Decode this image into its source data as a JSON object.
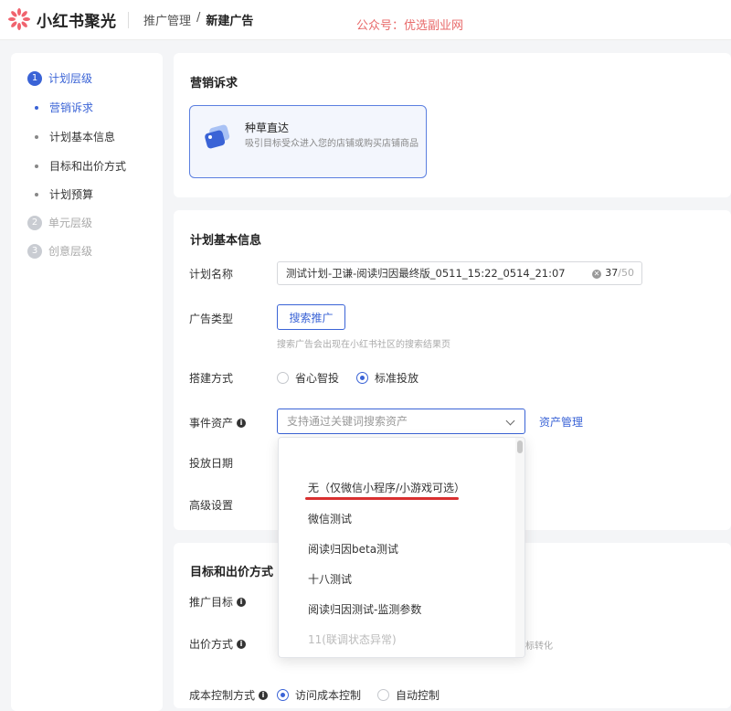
{
  "app": {
    "brand_name": "小红书聚光",
    "breadcrumb": [
      "推广管理",
      "/",
      "新建广告"
    ],
    "watermark": "公众号：优选副业网",
    "accent_color": "#3a63d6"
  },
  "sidebar": {
    "steps": [
      {
        "num": "1",
        "label": "计划层级",
        "state": "active"
      },
      {
        "num": "2",
        "label": "单元层级",
        "state": "inactive"
      },
      {
        "num": "3",
        "label": "创意层级",
        "state": "inactive"
      }
    ],
    "sub_items": [
      {
        "label": "营销诉求",
        "active": true
      },
      {
        "label": "计划基本信息",
        "active": false
      },
      {
        "label": "目标和出价方式",
        "active": false
      },
      {
        "label": "计划预算",
        "active": false
      }
    ]
  },
  "marketing": {
    "section_title": "营销诉求",
    "objective_title": "种草直达",
    "objective_desc": "吸引目标受众进入您的店铺或购买店铺商品"
  },
  "basic_info": {
    "section_title": "计划基本信息",
    "plan_name_label": "计划名称",
    "plan_name_value": "测试计划-卫谦-阅读归因最终版_0511_15:22_0514_21:07",
    "plan_name_count": "37",
    "plan_name_max": "/50",
    "ad_type_label": "广告类型",
    "ad_type_button": "搜索推广",
    "ad_type_hint": "搜索广告会出现在小红书社区的搜索结果页",
    "build_label": "搭建方式",
    "build_options": [
      "省心智投",
      "标准投放"
    ],
    "build_selected": "标准投放",
    "event_asset_label": "事件资产",
    "event_asset_placeholder": "支持通过关键词搜索资产",
    "asset_manage_link": "资产管理",
    "delivery_date_label": "投放日期",
    "advanced_label": "高级设置"
  },
  "dropdown": {
    "options": [
      {
        "label": "无（仅微信小程序/小游戏可选）",
        "disabled": false,
        "highlighted": true
      },
      {
        "label": "微信测试",
        "disabled": false
      },
      {
        "label": "阅读归因beta测试",
        "disabled": false
      },
      {
        "label": "十八测试",
        "disabled": false
      },
      {
        "label": "阅读归因测试-监测参数",
        "disabled": false
      },
      {
        "label": "11(联调状态异常)",
        "disabled": true
      }
    ]
  },
  "goals": {
    "section_title": "目标和出价方式",
    "promo_goal_label": "推广目标",
    "bid_method_label": "出价方式",
    "bid_hint_fragment": "标转化",
    "cost_control_label": "成本控制方式",
    "cost_control_options": [
      "访问成本控制",
      "自动控制"
    ],
    "cost_control_selected": "访问成本控制"
  }
}
